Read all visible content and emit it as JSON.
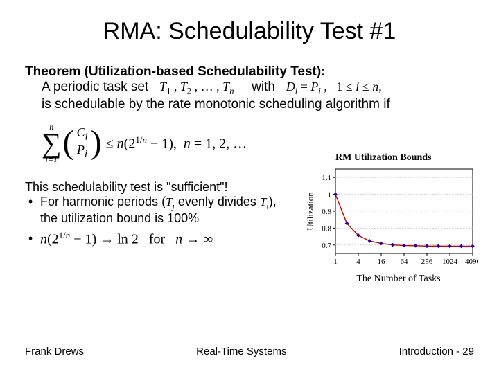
{
  "title": "RMA: Schedulability Test #1",
  "theorem": {
    "head": "Theorem (Utilization-based Schedulability Test):",
    "line1_prefix": "A periodic task set",
    "task_set_math": "T₁ , T₂ , … , Tₙ",
    "with": "with",
    "constraint_math": "Dᵢ = Pᵢ ,   1 ≤ i ≤ n,",
    "line2": "is schedulable by the rate monotonic scheduling algorithm if"
  },
  "formula": {
    "sum_top": "n",
    "sum_bottom": "i=1",
    "frac_num": "Cᵢ",
    "frac_den": "Pᵢ",
    "tail": "≤ n(2^{1/n} − 1),  n = 1, 2, …"
  },
  "notes": {
    "sufficient": "This schedulability test is \"sufficient\"!",
    "bullet_harmonic_a": "For harmonic periods (",
    "tj": "Tⱼ",
    "bullet_harmonic_b": " evenly divides ",
    "ti": "Tᵢ",
    "bullet_harmonic_c": "),",
    "bullet_harmonic_d": "the utilization bound is 100%",
    "limit_math": "n(2^{1/n} − 1) → ln 2   for   n → ∞"
  },
  "footer": {
    "left": "Frank Drews",
    "center": "Real-Time Systems",
    "right": "Introduction - 29"
  },
  "chart_data": {
    "type": "line",
    "title": "RM Utilization Bounds",
    "xlabel": "The Number of Tasks",
    "ylabel": "Utilization",
    "x": [
      1,
      2,
      4,
      8,
      16,
      32,
      64,
      128,
      256,
      512,
      1024,
      2048,
      4096
    ],
    "values": [
      1.0,
      0.828,
      0.757,
      0.724,
      0.709,
      0.701,
      0.697,
      0.696,
      0.694,
      0.694,
      0.693,
      0.693,
      0.693
    ],
    "x_ticks": [
      1,
      4,
      16,
      64,
      256,
      1024,
      4096
    ],
    "y_ticks": [
      0.7,
      0.8,
      0.9,
      1,
      1.1
    ],
    "xlim": [
      1,
      4096
    ],
    "ylim": [
      0.65,
      1.15
    ]
  }
}
